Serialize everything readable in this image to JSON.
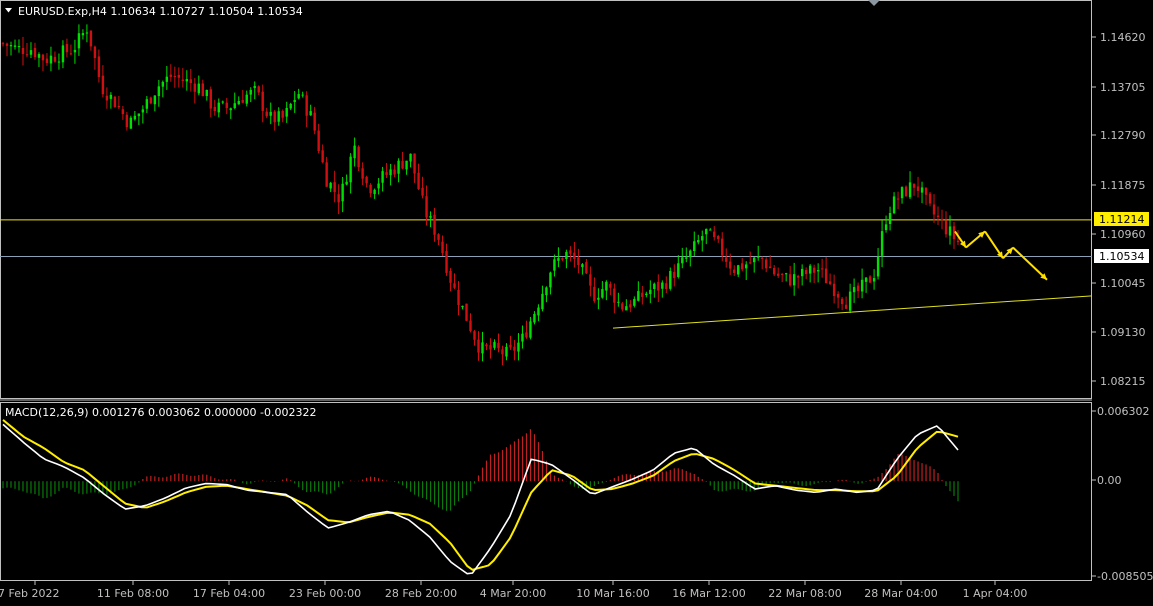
{
  "symbol_title": "EURUSD.Exp,H4  1.10634 1.10727 1.10504 1.10534",
  "price_label_yellow": "1.11214",
  "price_label_current": "1.10534",
  "macd_title": "MACD(12,26,9) 0.001276 0.003062 0.000000 -0.002322",
  "colors": {
    "background": "#000000",
    "bull": "#00e000",
    "bear": "#d01010",
    "axis": "#c0c0c0",
    "hline_yellow": "#f0e020",
    "hline_gray": "#8ca0b8",
    "trendline": "#e0e020",
    "arrows": "#ffe000",
    "macd_line": "#ffffff",
    "signal_line": "#ffee00",
    "hist_pos": "#c02020",
    "hist_neg": "#0a7a0a"
  },
  "chart_data": [
    {
      "type": "candlestick",
      "title": "EURUSD.Exp,H4",
      "ylim": [
        1.0775,
        1.1515
      ],
      "y_ticks": [
        "1.14620",
        "1.13705",
        "1.12790",
        "1.11875",
        "1.10960",
        "1.10045",
        "1.09130",
        "1.08215"
      ],
      "x_ticks": [
        "7 Feb 2022",
        "11 Feb 08:00",
        "17 Feb 04:00",
        "23 Feb 00:00",
        "28 Feb 20:00",
        "4 Mar 20:00",
        "10 Mar 16:00",
        "16 Mar 12:00",
        "22 Mar 08:00",
        "28 Mar 04:00",
        "1 Apr 04:00"
      ],
      "close_path": [
        1.145,
        1.144,
        1.144,
        1.142,
        1.143,
        1.144,
        1.148,
        1.137,
        1.134,
        1.13,
        1.133,
        1.137,
        1.139,
        1.138,
        1.137,
        1.133,
        1.133,
        1.135,
        1.136,
        1.131,
        1.131,
        1.136,
        1.131,
        1.12,
        1.116,
        1.126,
        1.118,
        1.12,
        1.122,
        1.124,
        1.114,
        1.109,
        1.1,
        1.094,
        1.088,
        1.088,
        1.087,
        1.09,
        1.096,
        1.103,
        1.106,
        1.104,
        1.098,
        1.1,
        1.096,
        1.097,
        1.099,
        1.1,
        1.103,
        1.106,
        1.11,
        1.107,
        1.103,
        1.104,
        1.105,
        1.102,
        1.101,
        1.102,
        1.103,
        1.1,
        1.097,
        1.099,
        1.102,
        1.114,
        1.117,
        1.119,
        1.114,
        1.111,
        1.108
      ],
      "horizontal_lines": [
        1.11214,
        1.10534
      ],
      "trendline": {
        "from": [
          "10 Mar 16:00",
          1.092
        ],
        "to": [
          "1 Apr 04:00",
          1.098
        ]
      },
      "projection_arrows": [
        1.11,
        1.107,
        1.11,
        1.105,
        1.107,
        1.101
      ]
    },
    {
      "type": "macd",
      "params": "12,26,9",
      "values": {
        "macd": 0.001276,
        "signal": 0.003062,
        "histogram": 0.0,
        "extra": -0.002322
      },
      "ylim": [
        -0.009,
        0.0066
      ],
      "y_ticks": [
        "0.006302",
        "0.00",
        "-0.008505"
      ],
      "macd_path": [
        0.0051,
        0.0035,
        0.002,
        0.0013,
        0.0003,
        -0.0012,
        -0.0025,
        -0.0022,
        -0.0015,
        -0.0006,
        -0.0002,
        -0.0003,
        -0.0008,
        -0.001,
        -0.0012,
        -0.0028,
        -0.0042,
        -0.0037,
        -0.003,
        -0.0027,
        -0.0035,
        -0.005,
        -0.0072,
        -0.0085,
        -0.006,
        -0.003,
        0.002,
        0.0015,
        0.0002,
        -0.0012,
        -0.0005,
        0.0002,
        0.001,
        0.0025,
        0.003,
        0.0015,
        0.0005,
        -0.0007,
        -0.0004,
        -0.0008,
        -0.001,
        -0.0007,
        -0.001,
        -0.0008,
        0.002,
        0.0042,
        0.005,
        0.0028
      ],
      "signal_path": [
        0.0055,
        0.004,
        0.003,
        0.0017,
        0.001,
        -0.0005,
        -0.002,
        -0.0024,
        -0.0018,
        -0.001,
        -0.0005,
        -0.0004,
        -0.0007,
        -0.001,
        -0.0013,
        -0.0022,
        -0.0035,
        -0.0037,
        -0.0032,
        -0.0028,
        -0.003,
        -0.0038,
        -0.0055,
        -0.008,
        -0.0075,
        -0.005,
        -0.001,
        0.001,
        0.0005,
        -0.0008,
        -0.0007,
        -0.0002,
        0.0005,
        0.0018,
        0.0025,
        0.002,
        0.001,
        -0.0002,
        -0.0004,
        -0.0006,
        -0.0008,
        -0.0008,
        -0.0009,
        -0.0009,
        0.0005,
        0.003,
        0.0045,
        0.004
      ]
    }
  ]
}
